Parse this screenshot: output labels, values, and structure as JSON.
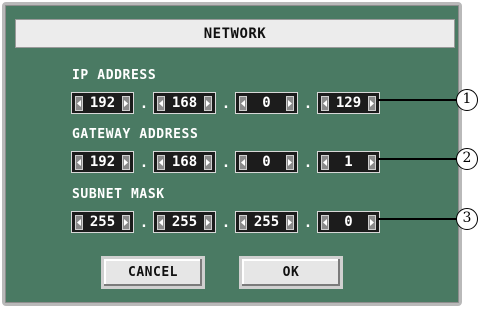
{
  "dialog": {
    "title": "NETWORK"
  },
  "ip": {
    "label": "IP ADDRESS",
    "octets": [
      "192",
      "168",
      "0",
      "129"
    ],
    "callout": "1"
  },
  "gateway": {
    "label": "GATEWAY ADDRESS",
    "octets": [
      "192",
      "168",
      "0",
      "1"
    ],
    "callout": "2"
  },
  "subnet": {
    "label": "SUBNET MASK",
    "octets": [
      "255",
      "255",
      "255",
      "0"
    ],
    "callout": "3"
  },
  "buttons": {
    "cancel": "CANCEL",
    "ok": "OK"
  },
  "separator": ".",
  "icons": {
    "decrement": "left-arrow-icon",
    "increment": "right-arrow-icon"
  },
  "colors": {
    "panel": "#4a7a63",
    "field": "#1c1c1c",
    "title_bar": "#ececec"
  }
}
